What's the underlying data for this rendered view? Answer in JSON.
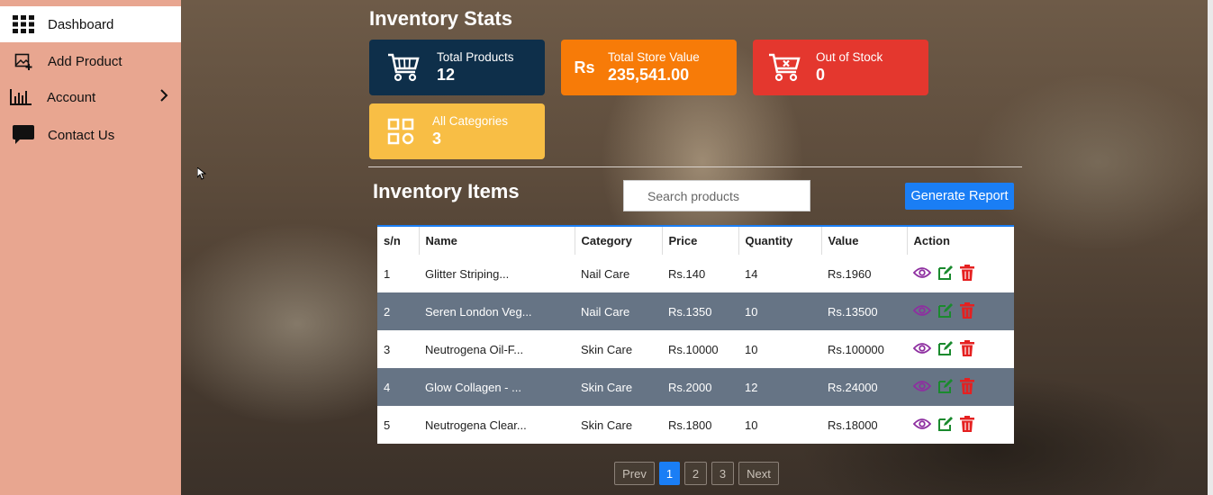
{
  "sidebar": {
    "items": [
      {
        "label": "Dashboard",
        "icon": "grid-icon"
      },
      {
        "label": "Add Product",
        "icon": "add-image-icon"
      },
      {
        "label": "Account",
        "icon": "bar-chart-icon"
      },
      {
        "label": "Contact Us",
        "icon": "chat-icon"
      }
    ]
  },
  "stats": {
    "title": "Inventory Stats",
    "cards": [
      {
        "label": "Total Products",
        "value": "12",
        "color": "#0e2f4a",
        "icon": "cart-icon"
      },
      {
        "label": "Total Store Value",
        "value": "235,541.00",
        "color": "#f77b08",
        "icon": "rupee-icon",
        "icon_text": "Rs"
      },
      {
        "label": "Out of Stock",
        "value": "0",
        "color": "#e4372e",
        "icon": "cart-x-icon"
      },
      {
        "label": "All Categories",
        "value": "3",
        "color": "#f8be45",
        "icon": "categories-icon"
      }
    ]
  },
  "items": {
    "title": "Inventory Items",
    "search_placeholder": "Search products",
    "generate_label": "Generate Report",
    "columns": [
      "s/n",
      "Name",
      "Category",
      "Price",
      "Quantity",
      "Value",
      "Action"
    ],
    "rows": [
      {
        "sn": "1",
        "name": "Glitter Striping...",
        "category": "Nail Care",
        "price": "Rs.140",
        "quantity": "14",
        "value": "Rs.1960"
      },
      {
        "sn": "2",
        "name": "Seren London Veg...",
        "category": "Nail Care",
        "price": "Rs.1350",
        "quantity": "10",
        "value": "Rs.13500"
      },
      {
        "sn": "3",
        "name": "Neutrogena Oil-F...",
        "category": "Skin Care",
        "price": "Rs.10000",
        "quantity": "10",
        "value": "Rs.100000"
      },
      {
        "sn": "4",
        "name": "Glow Collagen - ...",
        "category": "Skin Care",
        "price": "Rs.2000",
        "quantity": "12",
        "value": "Rs.24000"
      },
      {
        "sn": "5",
        "name": "Neutrogena Clear...",
        "category": "Skin Care",
        "price": "Rs.1800",
        "quantity": "10",
        "value": "Rs.18000"
      }
    ]
  },
  "pagination": {
    "prev": "Prev",
    "pages": [
      "1",
      "2",
      "3"
    ],
    "current": "1",
    "next": "Next"
  }
}
